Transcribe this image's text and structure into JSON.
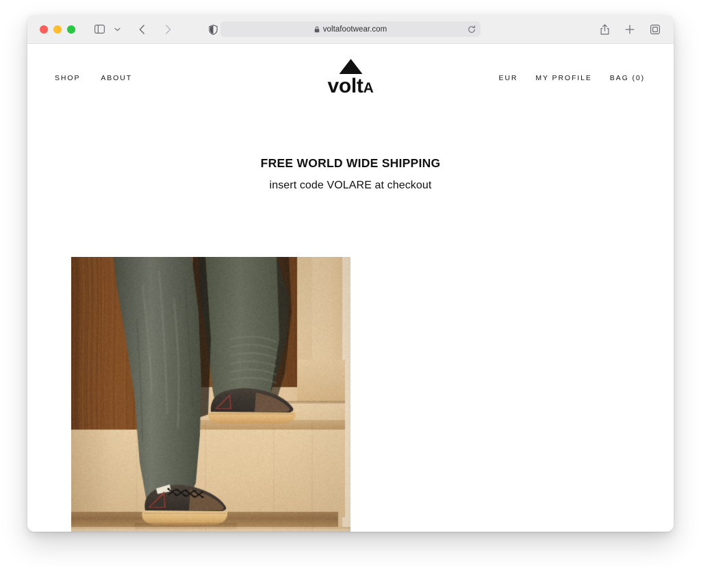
{
  "browser": {
    "traffic_lights": [
      "close",
      "minimize",
      "maximize"
    ],
    "sidebar_toggle_icon": "sidebar-icon",
    "sidebar_dropdown_icon": "chevron-down-icon",
    "back_icon": "chevron-left-icon",
    "forward_icon": "chevron-right-icon",
    "privacy_icon": "shield-half-icon",
    "lock_icon": "lock-icon",
    "url": "voltafootwear.com",
    "reload_icon": "reload-icon",
    "share_icon": "share-icon",
    "new_tab_icon": "plus-icon",
    "tab_overview_icon": "tab-overview-icon"
  },
  "site": {
    "nav_left": [
      {
        "label": "SHOP",
        "name": "shop"
      },
      {
        "label": "ABOUT",
        "name": "about"
      }
    ],
    "nav_right": [
      {
        "label": "EUR",
        "name": "currency"
      },
      {
        "label": "MY PROFILE",
        "name": "my-profile"
      },
      {
        "label": "BAG (0)",
        "name": "bag"
      }
    ],
    "logo": {
      "wordmark_main": "volt",
      "wordmark_tail": "A",
      "triangle_color": "#111111"
    },
    "promo": {
      "line1": "FREE WORLD WIDE SHIPPING",
      "line2": "insert code VOLARE at checkout"
    },
    "hero": {
      "alt": "Man in olive trousers wearing dark brown gum-sole shoes on beige stairs",
      "colors": {
        "wood_dark": "#7a4a24",
        "wood_mid": "#925c2e",
        "stair_light": "#e2c79e",
        "stair_mid": "#d4b287",
        "trouser": "#5d6253",
        "shoe_dark": "#3a332e",
        "shoe_brown": "#6b5340",
        "gum_sole": "#e0b87c",
        "accent_red": "#8e3b32"
      }
    }
  }
}
